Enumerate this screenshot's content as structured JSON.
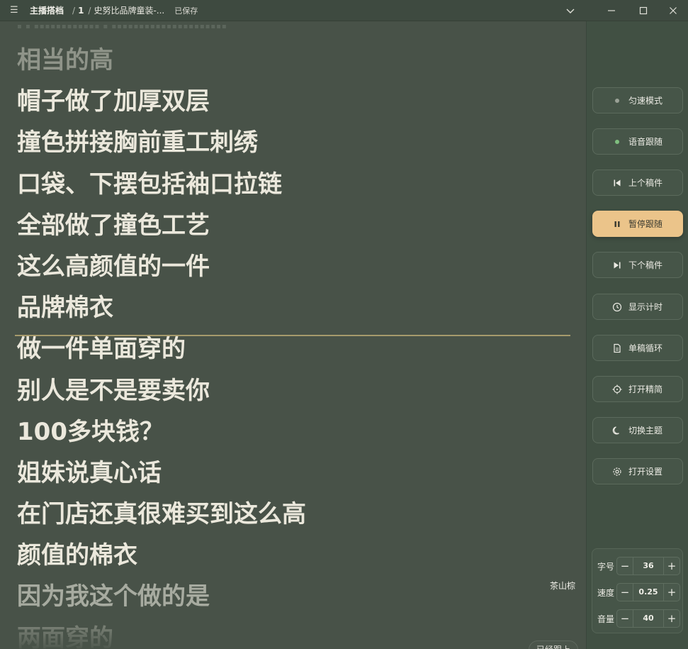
{
  "titlebar": {
    "app_title": "主播搭档",
    "separator": "/",
    "script_number": "1",
    "separator2": "/",
    "script_title": "史努比品牌童装-...",
    "saved_status": "已保存"
  },
  "script": {
    "ghost_header": "▪ ▪ ▪▪▪▪▪▪▪▪▪▪▪▪  ▪  ▪▪▪▪▪▪▪▪▪▪▪▪▪▪▪▪▪▪▪▪▪",
    "lines": [
      "相当的高",
      "帽子做了加厚双层",
      "撞色拼接胸前重工刺绣",
      "口袋、下摆包括袖口拉链",
      "全部做了撞色工艺",
      "这么高颜值的一件",
      "品牌棉衣",
      "做一件单面穿的",
      "别人是不是要卖你",
      "100多块钱？",
      "姐妹说真心话",
      "在门店还真很难买到这么高",
      "颜值的棉衣",
      "因为我这个做的是",
      "两面穿的"
    ],
    "theme_label": "茶山棕",
    "followed_badge": "已经跟上"
  },
  "side": {
    "buttons": [
      {
        "label": "匀速模式",
        "icon": "dot-icon"
      },
      {
        "label": "语音跟随",
        "icon": "green-dot-icon"
      },
      {
        "label": "上个稿件",
        "icon": "skip-previous-icon"
      },
      {
        "label": "暂停跟随",
        "icon": "pause-icon"
      },
      {
        "label": "下个稿件",
        "icon": "skip-next-icon"
      },
      {
        "label": "显示计时",
        "icon": "clock-icon"
      },
      {
        "label": "单稿循环",
        "icon": "document-icon"
      },
      {
        "label": "打开精简",
        "icon": "crosshair-icon"
      },
      {
        "label": "切换主题",
        "icon": "moon-icon"
      },
      {
        "label": "打开设置",
        "icon": "gear-icon"
      }
    ],
    "controls": {
      "font_size": {
        "label": "字号",
        "value": "36"
      },
      "speed": {
        "label": "速度",
        "value": "0.25"
      },
      "volume": {
        "label": "音量",
        "value": "40"
      }
    }
  },
  "colors": {
    "background": "#485248",
    "panel": "#415043",
    "accent": "#ebc48a",
    "guide": "#a69a6c",
    "active_dot": "#7fbf7f"
  }
}
